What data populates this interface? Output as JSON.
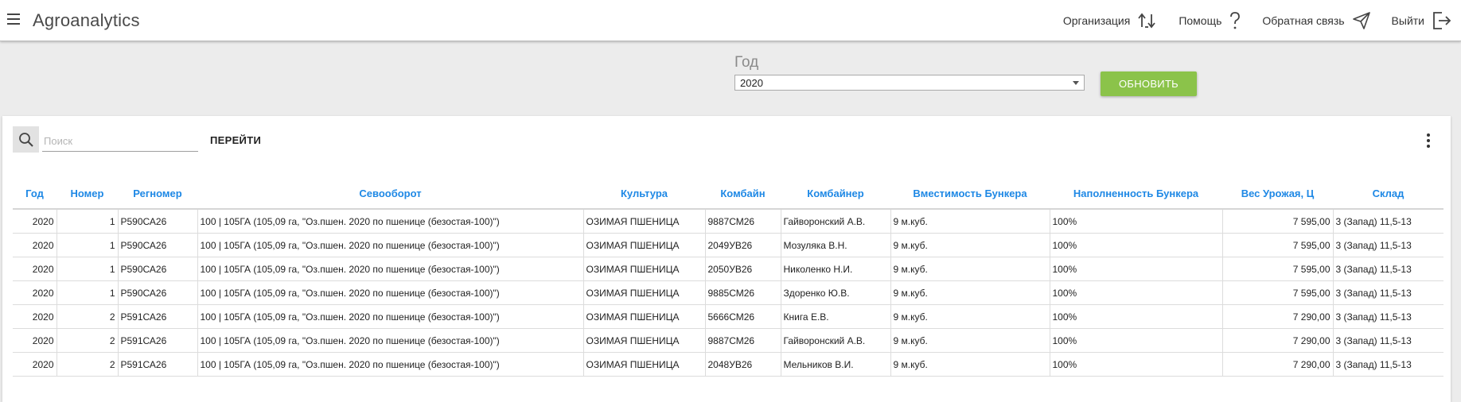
{
  "header": {
    "title": "Agroanalytics",
    "links": [
      {
        "label": "Организация",
        "icon": "swap-arrows-icon"
      },
      {
        "label": "Помощь",
        "icon": "question-icon"
      },
      {
        "label": "Обратная связь",
        "icon": "send-icon"
      },
      {
        "label": "Выйти",
        "icon": "logout-icon"
      }
    ]
  },
  "filters": {
    "year_label": "Год",
    "year_value": "2020",
    "refresh_label": "ОБНОВИТЬ"
  },
  "search": {
    "placeholder": "Поиск",
    "go_label": "ПЕРЕЙТИ"
  },
  "table": {
    "columns": [
      "Год",
      "Номер",
      "Регномер",
      "Севооборот",
      "Культура",
      "Комбайн",
      "Комбайнер",
      "Вместимость Бункера",
      "Наполненность Бункера",
      "Вес Урожая, Ц",
      "Склад"
    ],
    "rows": [
      [
        "2020",
        "1",
        "Р590СА26",
        "100 | 105ГА (105,09 га, \"Оз.пшен. 2020 по пшенице (безостая-100)\")",
        "ОЗИМАЯ ПШЕНИЦА",
        "9887СМ26",
        "Гайворонский А.В.",
        "9 м.куб.",
        "100%",
        "7 595,00",
        "3 (Запад) 11,5-13"
      ],
      [
        "2020",
        "1",
        "Р590СА26",
        "100 | 105ГА (105,09 га, \"Оз.пшен. 2020 по пшенице (безостая-100)\")",
        "ОЗИМАЯ ПШЕНИЦА",
        "2049УВ26",
        "Мозуляка В.Н.",
        "9 м.куб.",
        "100%",
        "7 595,00",
        "3 (Запад) 11,5-13"
      ],
      [
        "2020",
        "1",
        "Р590СА26",
        "100 | 105ГА (105,09 га, \"Оз.пшен. 2020 по пшенице (безостая-100)\")",
        "ОЗИМАЯ ПШЕНИЦА",
        "2050УВ26",
        "Николенко Н.И.",
        "9 м.куб.",
        "100%",
        "7 595,00",
        "3 (Запад) 11,5-13"
      ],
      [
        "2020",
        "1",
        "Р590СА26",
        "100 | 105ГА (105,09 га, \"Оз.пшен. 2020 по пшенице (безостая-100)\")",
        "ОЗИМАЯ ПШЕНИЦА",
        "9885СМ26",
        "Здоренко Ю.В.",
        "9 м.куб.",
        "100%",
        "7 595,00",
        "3 (Запад) 11,5-13"
      ],
      [
        "2020",
        "2",
        "Р591СА26",
        "100 | 105ГА (105,09 га, \"Оз.пшен. 2020 по пшенице (безостая-100)\")",
        "ОЗИМАЯ ПШЕНИЦА",
        "5666СМ26",
        "Книга Е.В.",
        "9 м.куб.",
        "100%",
        "7 290,00",
        "3 (Запад) 11,5-13"
      ],
      [
        "2020",
        "2",
        "Р591СА26",
        "100 | 105ГА (105,09 га, \"Оз.пшен. 2020 по пшенице (безостая-100)\")",
        "ОЗИМАЯ ПШЕНИЦА",
        "9887СМ26",
        "Гайворонский А.В.",
        "9 м.куб.",
        "100%",
        "7 290,00",
        "3 (Запад) 11,5-13"
      ],
      [
        "2020",
        "2",
        "Р591СА26",
        "100 | 105ГА (105,09 га, \"Оз.пшен. 2020 по пшенице (безостая-100)\")",
        "ОЗИМАЯ ПШЕНИЦА",
        "2048УВ26",
        "Мельников В.И.",
        "9 м.куб.",
        "100%",
        "7 290,00",
        "3 (Запад) 11,5-13"
      ]
    ]
  },
  "colors": {
    "accent": "#1e88e5",
    "button": "#8bc34a"
  }
}
